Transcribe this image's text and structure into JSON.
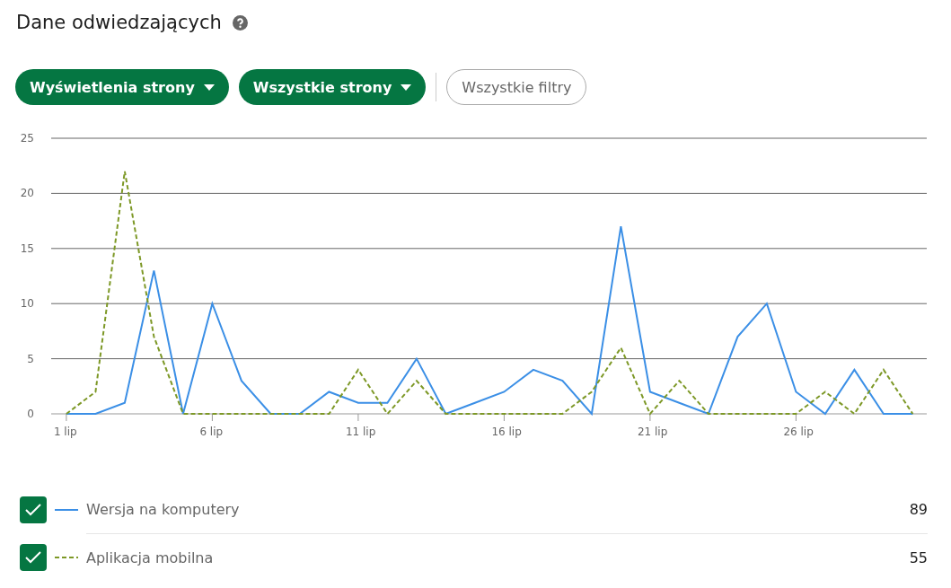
{
  "title": "Dane odwiedzających",
  "filters": [
    {
      "label": "Wyświetlenia strony",
      "kind": "dropdown"
    },
    {
      "label": "Wszystkie strony",
      "kind": "dropdown"
    },
    {
      "label": "Wszystkie filtry",
      "kind": "plain"
    }
  ],
  "chart": {
    "chart_data": {
      "type": "line",
      "x": [
        1,
        2,
        3,
        4,
        5,
        6,
        7,
        8,
        9,
        10,
        11,
        12,
        13,
        14,
        15,
        16,
        17,
        18,
        19,
        20,
        21,
        22,
        23,
        24,
        25,
        26,
        27,
        28,
        29,
        30
      ],
      "xticks": [
        {
          "value": 1,
          "label": "1 lip"
        },
        {
          "value": 6,
          "label": "6 lip"
        },
        {
          "value": 11,
          "label": "11 lip"
        },
        {
          "value": 16,
          "label": "16 lip"
        },
        {
          "value": 21,
          "label": "21 lip"
        },
        {
          "value": 26,
          "label": "26 lip"
        }
      ],
      "yticks": [
        0,
        5,
        10,
        15,
        20,
        25
      ],
      "ylim": [
        0,
        25
      ],
      "xlim": [
        0.48,
        30.48
      ],
      "grid": true,
      "series": [
        {
          "name": "Wersja na komputery",
          "color": "#3b8fe6",
          "line_style": "solid",
          "values": [
            0,
            0,
            1,
            13,
            0,
            10,
            3,
            0,
            0,
            2,
            1,
            1,
            5,
            0,
            1,
            2,
            4,
            3,
            0,
            17,
            2,
            1,
            0,
            7,
            10,
            2,
            0,
            4,
            0,
            0
          ]
        },
        {
          "name": "Aplikacja mobilna",
          "color": "#7d9826",
          "line_style": "dashed",
          "values": [
            0,
            2,
            22,
            7,
            0,
            0,
            0,
            0,
            0,
            0,
            4,
            0,
            3,
            0,
            0,
            0,
            0,
            0,
            2,
            6,
            0,
            3,
            0,
            0,
            0,
            0,
            2,
            0,
            4,
            0
          ]
        }
      ]
    }
  },
  "legend": [
    {
      "total": "89",
      "checked": true
    },
    {
      "total": "55",
      "checked": true
    }
  ]
}
